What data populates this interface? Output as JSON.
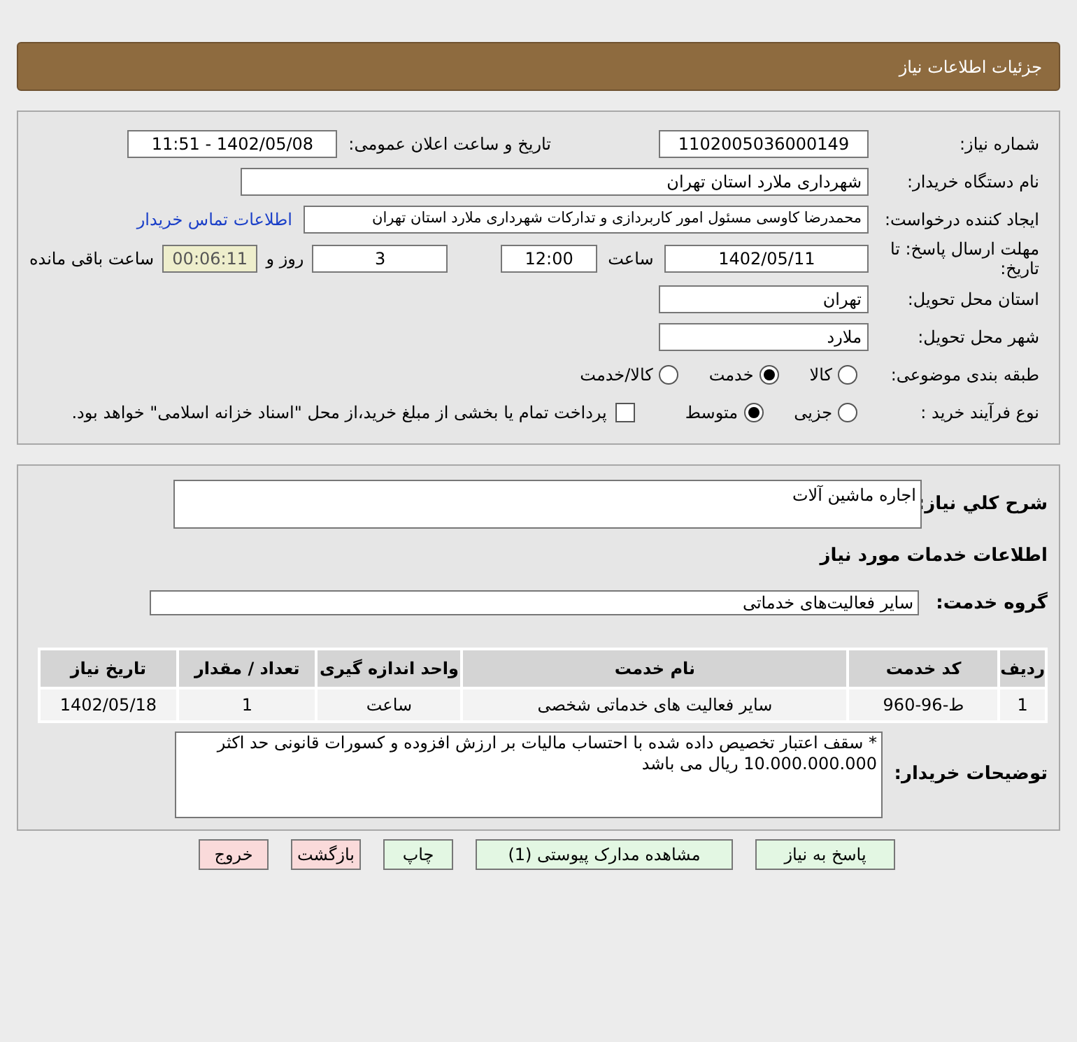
{
  "header": {
    "title": "جزئیات اطلاعات نیاز"
  },
  "details": {
    "need_number": {
      "label": "شماره نیاز:",
      "value": "1102005036000149"
    },
    "announce": {
      "label": "تاریخ و ساعت اعلان عمومی:",
      "value": "1402/05/08 - 11:51"
    },
    "buyer": {
      "label": "نام دستگاه خریدار:",
      "value": "شهرداری ملارد استان تهران"
    },
    "requester": {
      "label": "ایجاد کننده درخواست:",
      "value": "محمدرضا کاوسی مسئول امور کاربردازی و تدارکات  شهرداری ملارد استان تهران",
      "link": "اطلاعات تماس خریدار"
    },
    "deadline": {
      "label": "مهلت ارسال پاسخ: تا تاریخ:",
      "date": "1402/05/11",
      "time_label": "ساعت",
      "time": "12:00",
      "days": "3",
      "days_label": "روز و",
      "remaining": "00:06:11",
      "remaining_label": "ساعت باقی مانده"
    },
    "province": {
      "label": "استان محل تحویل:",
      "value": "تهران"
    },
    "city": {
      "label": "شهر محل تحویل:",
      "value": "ملارد"
    },
    "category": {
      "label": "طبقه بندی موضوعی:",
      "options": [
        {
          "label": "کالا",
          "selected": false
        },
        {
          "label": "خدمت",
          "selected": true
        },
        {
          "label": "کالا/خدمت",
          "selected": false
        }
      ]
    },
    "process": {
      "label": "نوع فرآیند خرید :",
      "options": [
        {
          "label": "جزیی",
          "selected": false
        },
        {
          "label": "متوسط",
          "selected": true
        }
      ],
      "payment": {
        "label": "پرداخت تمام یا بخشی از مبلغ خرید،از محل \"اسناد خزانه اسلامی\" خواهد بود.",
        "checked": false
      }
    }
  },
  "services": {
    "summary": {
      "label": "شرح کلي نياز:",
      "value": "اجاره ماشین آلات"
    },
    "heading": "اطلاعات خدمات مورد نیاز",
    "group": {
      "label": "گروه خدمت:",
      "value": "سایر فعالیت‌های خدماتی"
    },
    "table": {
      "columns": [
        "ردیف",
        "کد خدمت",
        "نام خدمت",
        "واحد اندازه گیری",
        "تعداد / مقدار",
        "تاریخ نیاز"
      ],
      "rows": [
        [
          "1",
          "ط-96-960",
          "سایر فعالیت های خدماتی شخصی",
          "ساعت",
          "1",
          "1402/05/18"
        ]
      ]
    },
    "notes": {
      "label": "توضیحات خریدار:",
      "value": "* سقف اعتبار تخصیص داده شده با احتساب مالیات بر ارزش افزوده و کسورات قانونی حد اکثر 10.000.000.000 ریال می باشد"
    }
  },
  "buttons": [
    {
      "label": "پاسخ به نیاز",
      "kind": "normal"
    },
    {
      "label": "مشاهده مدارک پیوستی (1)",
      "kind": "normal"
    },
    {
      "label": "چاپ",
      "kind": "normal"
    },
    {
      "label": "بازگشت",
      "kind": "danger"
    },
    {
      "label": "خروج",
      "kind": "danger"
    }
  ]
}
